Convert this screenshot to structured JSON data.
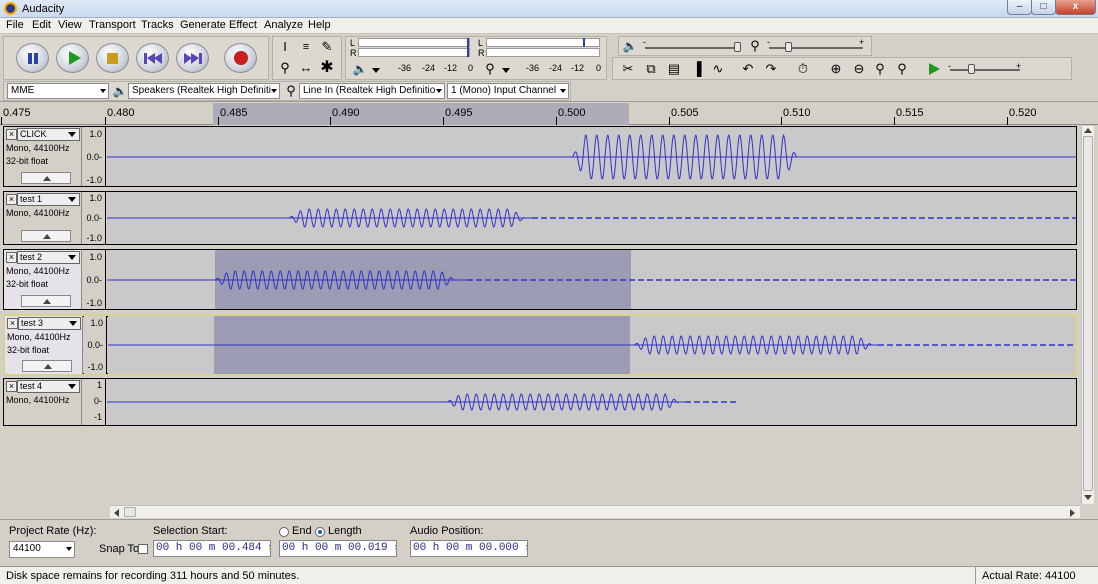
{
  "window": {
    "title": "Audacity",
    "minimize_label": "–",
    "maximize_label": "□",
    "close_label": "x"
  },
  "menu": [
    "File",
    "Edit",
    "View",
    "Transport",
    "Tracks",
    "Generate",
    "Effect",
    "Analyze",
    "Help"
  ],
  "toolbar": {
    "meter_scale_labels": [
      "-36",
      "-24",
      "-12",
      "0"
    ],
    "meter_channel_left": "L",
    "meter_channel_right": "R",
    "slider_plus": "+",
    "slider_minus": "-"
  },
  "device": {
    "host": "MME",
    "output": "Speakers (Realtek High Definiti",
    "input": "Line In (Realtek High Definitio",
    "channels": "1 (Mono) Input Channel"
  },
  "ruler": {
    "labels": [
      "0.475",
      "0.480",
      "0.485",
      "0.490",
      "0.495",
      "0.500",
      "0.505",
      "0.510",
      "0.515",
      "0.520"
    ]
  },
  "tracks": [
    {
      "name": "CLICK",
      "info1": "Mono, 44100Hz",
      "info2": "32-bit float",
      "scale": [
        "1.0",
        "0.0-",
        "-1.0"
      ]
    },
    {
      "name": "test 1",
      "info1": "Mono, 44100Hz",
      "info2": "",
      "scale": [
        "1.0",
        "0.0-",
        "-1.0"
      ]
    },
    {
      "name": "test 2",
      "info1": "Mono, 44100Hz",
      "info2": "32-bit float",
      "scale": [
        "1.0",
        "0.0-",
        "-1.0"
      ]
    },
    {
      "name": "test 3",
      "info1": "Mono, 44100Hz",
      "info2": "32-bit float",
      "scale": [
        "1.0",
        "0.0-",
        "-1.0"
      ]
    },
    {
      "name": "test 4",
      "info1": "Mono, 44100Hz",
      "info2": "",
      "scale": [
        "1",
        "0-",
        "-1"
      ]
    }
  ],
  "selection_bar": {
    "project_rate_label": "Project Rate (Hz):",
    "project_rate": "44100",
    "snap_to_label": "Snap To",
    "selection_start_label": "Selection Start:",
    "selection_start": "00 h 00 m 00.484 s",
    "end_label": "End",
    "length_label": "Length",
    "length": "00 h 00 m 00.019 s",
    "audio_position_label": "Audio Position:",
    "audio_position": "00 h 00 m 00.000 s"
  },
  "status": {
    "message": "Disk space remains for recording 311 hours and 50 minutes.",
    "actual_rate": "Actual Rate: 44100"
  },
  "colors": {
    "waveform": "#3232c8",
    "selection": "#9c9cb4",
    "background": "#d4d0c8"
  }
}
